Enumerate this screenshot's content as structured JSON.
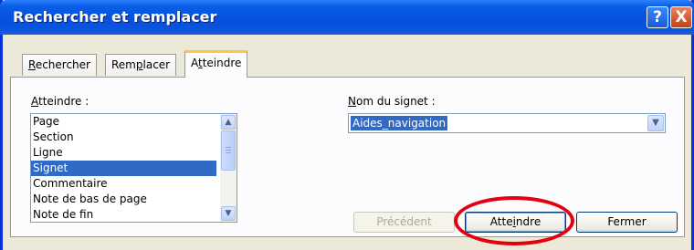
{
  "window": {
    "title": "Rechercher et remplacer",
    "help_label": "?",
    "close_label": "X"
  },
  "tabs": [
    {
      "label": "Rechercher",
      "access_key": "R",
      "rest": "echercher",
      "active": false
    },
    {
      "label": "Remplacer",
      "before": "Rem",
      "access_key": "p",
      "rest": "lacer",
      "active": false
    },
    {
      "label": "Atteindre",
      "before": "A",
      "access_key": "t",
      "rest": "teindre",
      "active": true
    }
  ],
  "goto_panel": {
    "target_label": "Atteindre :",
    "target_label_key": "A",
    "target_label_rest": "tteindre :",
    "items": [
      "Page",
      "Section",
      "Ligne",
      "Signet",
      "Commentaire",
      "Note de bas de page",
      "Note de fin"
    ],
    "selected_item": "Signet",
    "bookmark_label": "Nom du signet :",
    "bookmark_label_key": "N",
    "bookmark_label_rest": "om du signet :",
    "bookmark_value": "Aides_navigation"
  },
  "buttons": {
    "previous": "Précédent",
    "goto": "Atteindre",
    "goto_before": "Atte",
    "goto_key": "i",
    "goto_rest": "ndre",
    "close": "Fermer"
  },
  "icons": {
    "scroll_up": "arrow-up-icon",
    "scroll_down": "arrow-down-icon",
    "combo_dropdown": "chevron-down-icon"
  },
  "colors": {
    "titlebar": "#0650dc",
    "selection": "#316ac5",
    "active_tab_accent": "#ffc83c",
    "highlight_ring": "#e3000f"
  }
}
